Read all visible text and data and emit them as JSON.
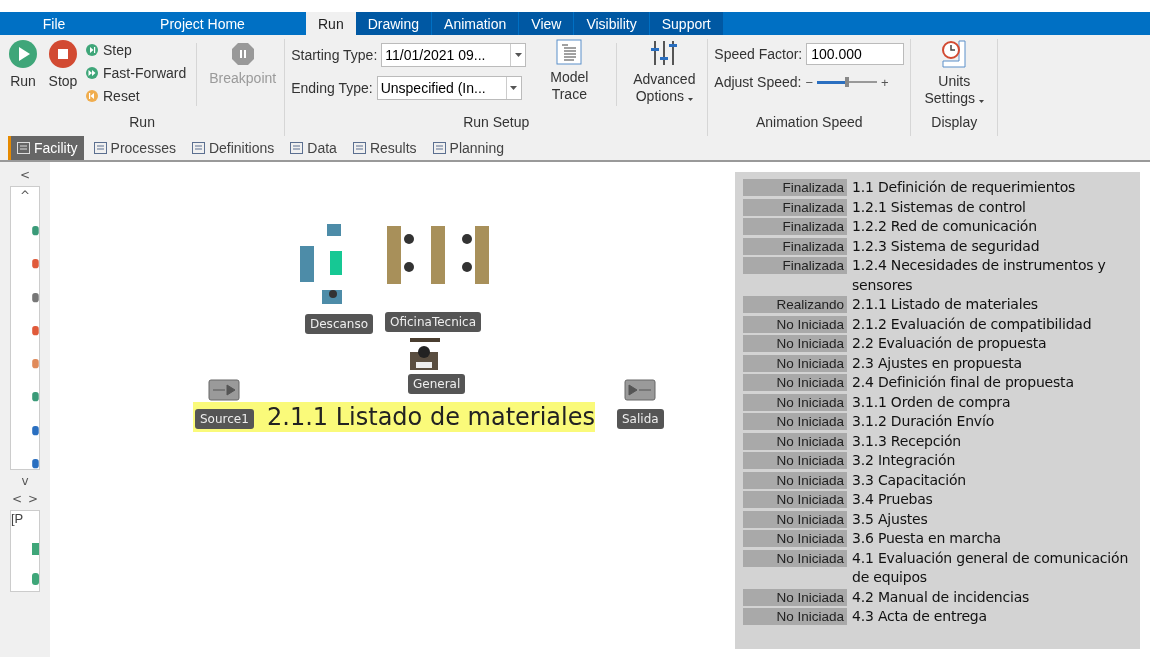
{
  "menu_tabs": [
    {
      "label": "File",
      "selected": false
    },
    {
      "label": "Project Home",
      "selected": false
    },
    {
      "label": "Run",
      "selected": true
    },
    {
      "label": "Drawing",
      "selected": false
    },
    {
      "label": "Animation",
      "selected": false
    },
    {
      "label": "View",
      "selected": false
    },
    {
      "label": "Visibility",
      "selected": false
    },
    {
      "label": "Support",
      "selected": false
    }
  ],
  "ribbon": {
    "run_group": {
      "title": "Run",
      "run": "Run",
      "stop": "Stop",
      "step": "Step",
      "fast_forward": "Fast-Forward",
      "reset": "Reset",
      "breakpoint": "Breakpoint",
      "breakpoint_disabled": true
    },
    "run_setup": {
      "title": "Run Setup",
      "starting_label": "Starting Type:",
      "starting_value": "11/01/2021 09...",
      "ending_label": "Ending Type:",
      "ending_value": "Unspecified (In...",
      "model_trace": "Model Trace",
      "advanced_options": "Advanced Options"
    },
    "animation_speed": {
      "title": "Animation Speed",
      "speed_factor_label": "Speed Factor:",
      "speed_factor": "100.000",
      "adjust_label": "Adjust Speed:",
      "minus": "−",
      "plus": "+",
      "level": 0.5
    },
    "display": {
      "title": "Display",
      "units_settings": "Units Settings"
    }
  },
  "view_tabs": [
    {
      "label": "Facility",
      "selected": true
    },
    {
      "label": "Processes",
      "selected": false
    },
    {
      "label": "Definitions",
      "selected": false
    },
    {
      "label": "Data",
      "selected": false
    },
    {
      "label": "Results",
      "selected": false
    },
    {
      "label": "Planning",
      "selected": false
    }
  ],
  "sidebar": {
    "back": "<",
    "up": "^",
    "down": "v",
    "left": "<",
    "right": ">",
    "section_label": "[P"
  },
  "canvas": {
    "nodes": [
      {
        "label": "Descanso",
        "kind": "lounge"
      },
      {
        "label": "OficinaTecnica",
        "kind": "office"
      },
      {
        "label": "Source1",
        "kind": "source"
      },
      {
        "label": "General",
        "kind": "desk"
      },
      {
        "label": "Salida",
        "kind": "sink"
      }
    ],
    "banner": "2.1.1 Listado de materiales"
  },
  "tasks": [
    {
      "status": "Finalizada",
      "name": "1.1 Definición de requerimientos"
    },
    {
      "status": "Finalizada",
      "name": "1.2.1 Sistemas de control"
    },
    {
      "status": "Finalizada",
      "name": "1.2.2 Red de comunicación"
    },
    {
      "status": "Finalizada",
      "name": "1.2.3 Sistema de seguridad"
    },
    {
      "status": "Finalizada",
      "name": "1.2.4 Necesidades de instrumentos y sensores"
    },
    {
      "status": "Realizando",
      "name": "2.1.1 Listado de materiales"
    },
    {
      "status": "No Iniciada",
      "name": "2.1.2 Evaluación de compatibilidad"
    },
    {
      "status": "No Iniciada",
      "name": "2.2 Evaluación de propuesta"
    },
    {
      "status": "No Iniciada",
      "name": "2.3 Ajustes en propuesta"
    },
    {
      "status": "No Iniciada",
      "name": "2.4 Definición final de propuesta"
    },
    {
      "status": "No Iniciada",
      "name": "3.1.1 Orden de compra"
    },
    {
      "status": "No Iniciada",
      "name": "3.1.2 Duración Envío"
    },
    {
      "status": "No Iniciada",
      "name": "3.1.3 Recepción"
    },
    {
      "status": "No Iniciada",
      "name": "3.2 Integración"
    },
    {
      "status": "No Iniciada",
      "name": "3.3 Capacitación"
    },
    {
      "status": "No Iniciada",
      "name": "3.4 Pruebas"
    },
    {
      "status": "No Iniciada",
      "name": "3.5 Ajustes"
    },
    {
      "status": "No Iniciada",
      "name": "3.6 Puesta en marcha"
    },
    {
      "status": "No Iniciada",
      "name": "4.1 Evaluación general de comunicación de equipos"
    },
    {
      "status": "No Iniciada",
      "name": "4.2 Manual de incidencias"
    },
    {
      "status": "No Iniciada",
      "name": "4.3 Acta de entrega"
    }
  ]
}
